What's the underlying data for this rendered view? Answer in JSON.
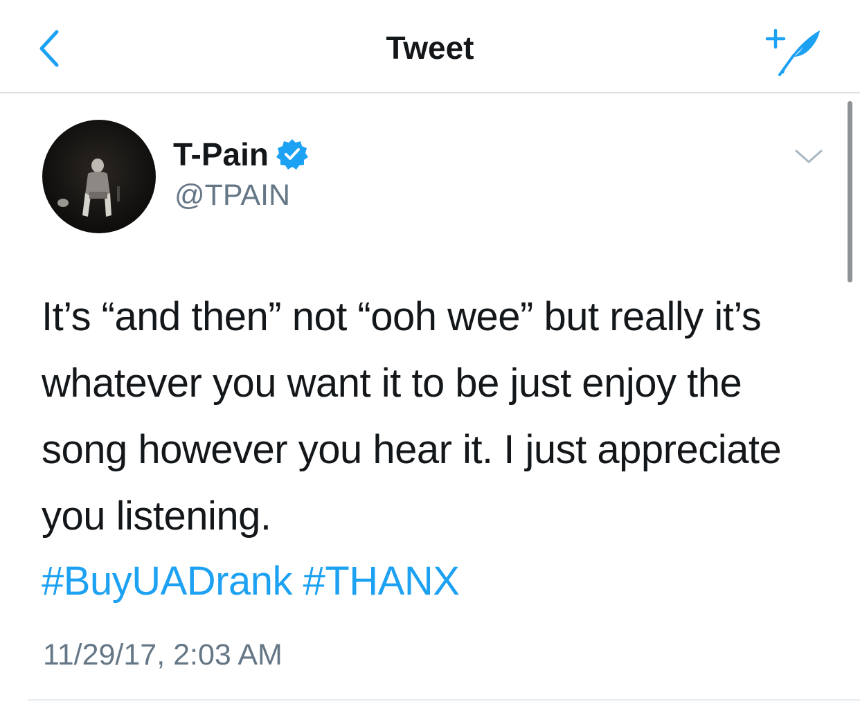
{
  "nav": {
    "title": "Tweet",
    "back_icon": "chevron-left-icon",
    "compose_icon": "compose-tweet-icon",
    "accent_color": "#1da1f2"
  },
  "tweet": {
    "author": {
      "name": "T-Pain",
      "handle": "@TPAIN",
      "verified": true,
      "verified_icon": "verified-badge-icon"
    },
    "text": "It’s “and then” not “ooh wee” but really it’s whatever you want it to be just enjoy the song however you hear it. I just appreciate you listening.",
    "hashtags": [
      "#BuyUADrank",
      "#THANX"
    ],
    "timestamp": "11/29/17, 2:03 AM",
    "menu_icon": "chevron-down-icon"
  },
  "colors": {
    "text_primary": "#14171a",
    "text_secondary": "#657786",
    "link": "#1da1f2",
    "divider": "#e6ecf0"
  }
}
